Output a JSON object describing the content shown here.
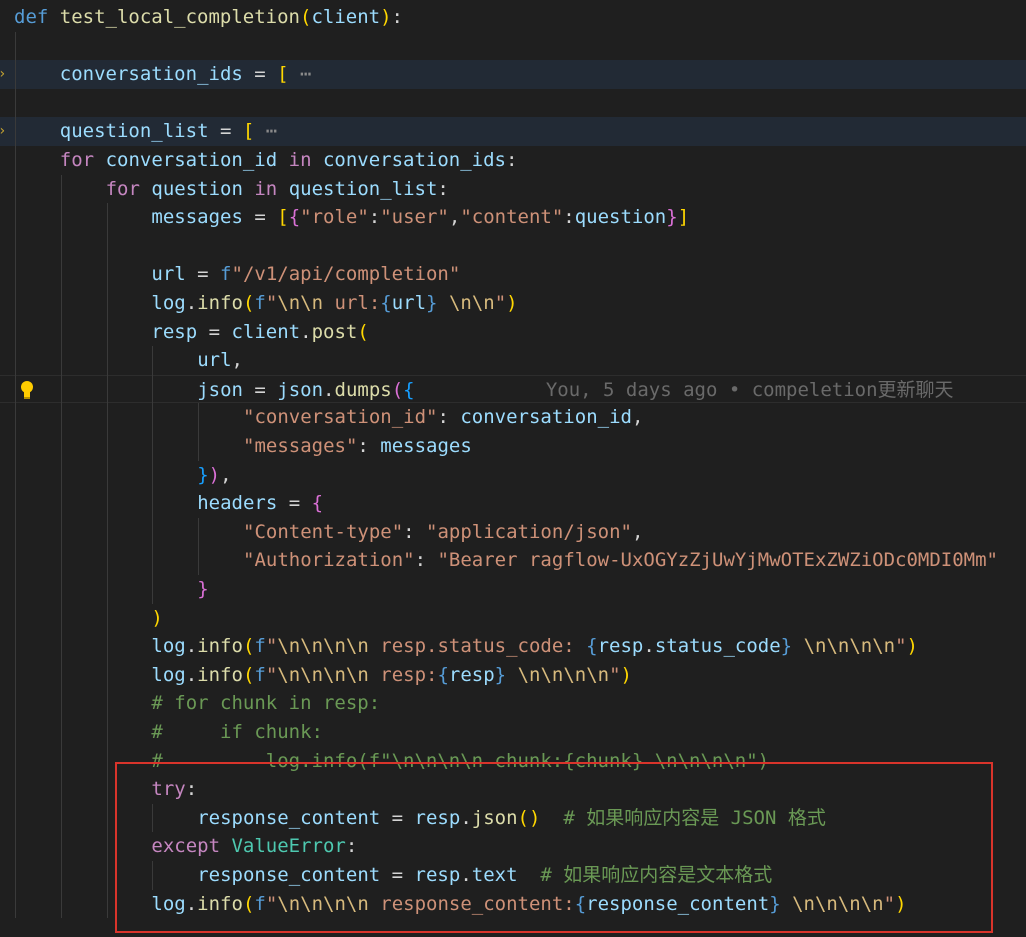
{
  "editor": {
    "blame": "You, 5 days ago • compeletion更新聊天",
    "lines": [
      {
        "tokens": [
          [
            "def",
            "k"
          ],
          [
            " ",
            "w"
          ],
          [
            "test_local_completion",
            "f"
          ],
          [
            "(",
            "p1"
          ],
          [
            "client",
            "v"
          ],
          [
            ")",
            "p1"
          ],
          [
            ":",
            "w"
          ]
        ]
      },
      {
        "tokens": []
      },
      {
        "tokens": [
          [
            "conversation_ids",
            "v"
          ],
          [
            " = ",
            "w"
          ],
          [
            "[",
            "p1"
          ],
          [
            " ⋯",
            "ell"
          ]
        ]
      },
      {
        "tokens": []
      },
      {
        "tokens": [
          [
            "question_list",
            "v"
          ],
          [
            " = ",
            "w"
          ],
          [
            "[",
            "p1"
          ],
          [
            " ⋯",
            "ell"
          ]
        ]
      },
      {
        "tokens": [
          [
            "for",
            "c"
          ],
          [
            " ",
            "w"
          ],
          [
            "conversation_id",
            "v"
          ],
          [
            " ",
            "w"
          ],
          [
            "in",
            "c"
          ],
          [
            " ",
            "w"
          ],
          [
            "conversation_ids",
            "v"
          ],
          [
            ":",
            "w"
          ]
        ]
      },
      {
        "tokens": [
          [
            "for",
            "c"
          ],
          [
            " ",
            "w"
          ],
          [
            "question",
            "v"
          ],
          [
            " ",
            "w"
          ],
          [
            "in",
            "c"
          ],
          [
            " ",
            "w"
          ],
          [
            "question_list",
            "v"
          ],
          [
            ":",
            "w"
          ]
        ]
      },
      {
        "tokens": [
          [
            "messages",
            "v"
          ],
          [
            " = ",
            "w"
          ],
          [
            "[",
            "p1"
          ],
          [
            "{",
            "p2"
          ],
          [
            "\"role\"",
            "s"
          ],
          [
            ":",
            "w"
          ],
          [
            "\"user\"",
            "s"
          ],
          [
            ",",
            "w"
          ],
          [
            "\"content\"",
            "s"
          ],
          [
            ":",
            "w"
          ],
          [
            "question",
            "v"
          ],
          [
            "}",
            "p2"
          ],
          [
            "]",
            "p1"
          ]
        ]
      },
      {
        "tokens": []
      },
      {
        "tokens": [
          [
            "url",
            "v"
          ],
          [
            " = ",
            "w"
          ],
          [
            "f",
            "k"
          ],
          [
            "\"/v1/api/completion\"",
            "s"
          ]
        ]
      },
      {
        "tokens": [
          [
            "log",
            "v"
          ],
          [
            ".",
            "w"
          ],
          [
            "info",
            "f"
          ],
          [
            "(",
            "p1"
          ],
          [
            "f",
            "k"
          ],
          [
            "\"",
            "s"
          ],
          [
            "\\n\\n",
            "e"
          ],
          [
            " url:",
            "s"
          ],
          [
            "{",
            "k"
          ],
          [
            "url",
            "v"
          ],
          [
            "}",
            "k"
          ],
          [
            " ",
            "s"
          ],
          [
            "\\n\\n",
            "e"
          ],
          [
            "\"",
            "s"
          ],
          [
            ")",
            "p1"
          ]
        ]
      },
      {
        "tokens": [
          [
            "resp",
            "v"
          ],
          [
            " = ",
            "w"
          ],
          [
            "client",
            "v"
          ],
          [
            ".",
            "w"
          ],
          [
            "post",
            "f"
          ],
          [
            "(",
            "p1"
          ]
        ]
      },
      {
        "tokens": [
          [
            "url",
            "v"
          ],
          [
            ",",
            "w"
          ]
        ]
      },
      {
        "tokens": [
          [
            "json",
            "v"
          ],
          [
            " = ",
            "w"
          ],
          [
            "json",
            "v"
          ],
          [
            ".",
            "w"
          ],
          [
            "dumps",
            "f"
          ],
          [
            "(",
            "p2"
          ],
          [
            "{",
            "p3"
          ]
        ]
      },
      {
        "tokens": [
          [
            "\"conversation_id\"",
            "s"
          ],
          [
            ": ",
            "w"
          ],
          [
            "conversation_id",
            "v"
          ],
          [
            ",",
            "w"
          ]
        ]
      },
      {
        "tokens": [
          [
            "\"messages\"",
            "s"
          ],
          [
            ": ",
            "w"
          ],
          [
            "messages",
            "v"
          ]
        ]
      },
      {
        "tokens": [
          [
            "}",
            "p3"
          ],
          [
            ")",
            "p2"
          ],
          [
            ",",
            "w"
          ]
        ]
      },
      {
        "tokens": [
          [
            "headers",
            "v"
          ],
          [
            " = ",
            "w"
          ],
          [
            "{",
            "p2"
          ]
        ]
      },
      {
        "tokens": [
          [
            "\"Content-type\"",
            "s"
          ],
          [
            ": ",
            "w"
          ],
          [
            "\"application/json\"",
            "s"
          ],
          [
            ",",
            "w"
          ]
        ]
      },
      {
        "tokens": [
          [
            "\"Authorization\"",
            "s"
          ],
          [
            ": ",
            "w"
          ],
          [
            "\"Bearer ragflow-UxOGYzZjUwYjMwOTExZWZiODc0MDI0Mm\"",
            "s"
          ]
        ]
      },
      {
        "tokens": [
          [
            "}",
            "p2"
          ]
        ]
      },
      {
        "tokens": [
          [
            ")",
            "p1"
          ]
        ]
      },
      {
        "tokens": [
          [
            "log",
            "v"
          ],
          [
            ".",
            "w"
          ],
          [
            "info",
            "f"
          ],
          [
            "(",
            "p1"
          ],
          [
            "f",
            "k"
          ],
          [
            "\"",
            "s"
          ],
          [
            "\\n\\n\\n\\n",
            "e"
          ],
          [
            " resp.status_code: ",
            "s"
          ],
          [
            "{",
            "k"
          ],
          [
            "resp",
            "v"
          ],
          [
            ".",
            "w"
          ],
          [
            "status_code",
            "v"
          ],
          [
            "}",
            "k"
          ],
          [
            " ",
            "s"
          ],
          [
            "\\n\\n\\n\\n",
            "e"
          ],
          [
            "\"",
            "s"
          ],
          [
            ")",
            "p1"
          ]
        ]
      },
      {
        "tokens": [
          [
            "log",
            "v"
          ],
          [
            ".",
            "w"
          ],
          [
            "info",
            "f"
          ],
          [
            "(",
            "p1"
          ],
          [
            "f",
            "k"
          ],
          [
            "\"",
            "s"
          ],
          [
            "\\n\\n\\n\\n",
            "e"
          ],
          [
            " resp:",
            "s"
          ],
          [
            "{",
            "k"
          ],
          [
            "resp",
            "v"
          ],
          [
            "}",
            "k"
          ],
          [
            " ",
            "s"
          ],
          [
            "\\n\\n\\n\\n",
            "e"
          ],
          [
            "\"",
            "s"
          ],
          [
            ")",
            "p1"
          ]
        ]
      },
      {
        "tokens": [
          [
            "# for chunk in resp:",
            "cm"
          ]
        ]
      },
      {
        "tokens": [
          [
            "#     if chunk:",
            "cm"
          ]
        ]
      },
      {
        "tokens": [
          [
            "#         log.info(f\"\\n\\n\\n\\n chunk:{chunk} \\n\\n\\n\\n\")",
            "cm"
          ]
        ]
      },
      {
        "tokens": [
          [
            "try",
            "c"
          ],
          [
            ":",
            "w"
          ]
        ]
      },
      {
        "tokens": [
          [
            "response_content",
            "v"
          ],
          [
            " = ",
            "w"
          ],
          [
            "resp",
            "v"
          ],
          [
            ".",
            "w"
          ],
          [
            "json",
            "f"
          ],
          [
            "(",
            "p1"
          ],
          [
            ")",
            "p1"
          ],
          [
            "  ",
            "w"
          ],
          [
            "# 如果响应内容是 JSON 格式",
            "cm"
          ]
        ]
      },
      {
        "tokens": [
          [
            "except",
            "c"
          ],
          [
            " ",
            "w"
          ],
          [
            "ValueError",
            "t"
          ],
          [
            ":",
            "w"
          ]
        ]
      },
      {
        "tokens": [
          [
            "response_content",
            "v"
          ],
          [
            " = ",
            "w"
          ],
          [
            "resp",
            "v"
          ],
          [
            ".",
            "w"
          ],
          [
            "text",
            "v"
          ],
          [
            "  ",
            "w"
          ],
          [
            "# 如果响应内容是文本格式",
            "cm"
          ]
        ]
      },
      {
        "tokens": [
          [
            "log",
            "v"
          ],
          [
            ".",
            "w"
          ],
          [
            "info",
            "f"
          ],
          [
            "(",
            "p1"
          ],
          [
            "f",
            "k"
          ],
          [
            "\"",
            "s"
          ],
          [
            "\\n\\n\\n\\n",
            "e"
          ],
          [
            " response_content:",
            "s"
          ],
          [
            "{",
            "k"
          ],
          [
            "response_content",
            "v"
          ],
          [
            "}",
            "k"
          ],
          [
            " ",
            "s"
          ],
          [
            "\\n\\n\\n\\n",
            "e"
          ],
          [
            "\"",
            "s"
          ],
          [
            ")",
            "p1"
          ]
        ]
      }
    ]
  }
}
